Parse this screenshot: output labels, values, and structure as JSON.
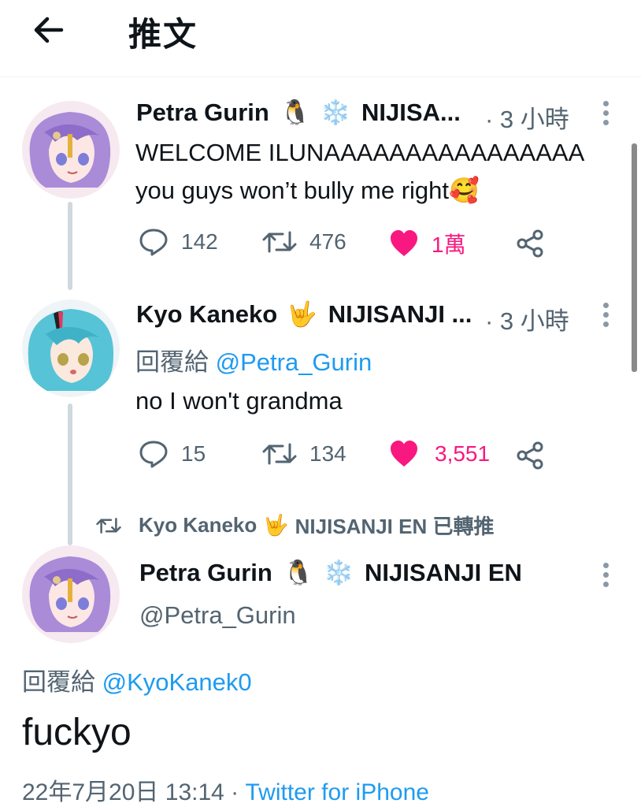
{
  "header": {
    "title": "推文"
  },
  "tweets": [
    {
      "name": "Petra Gurin",
      "emoji": [
        "🐧",
        "❄️"
      ],
      "org": "NIJISA...",
      "time": "· 3 小時",
      "lines": [
        "WELCOME ILUNAAAAAAAAAAAAAAAA",
        "you guys won’t bully me right🥰"
      ],
      "replies": "142",
      "retweets": "476",
      "likes": "1萬"
    },
    {
      "name": "Kyo Kaneko",
      "emoji": [
        "🤟"
      ],
      "org": "NIJISANJI ...",
      "time": "· 3 小時",
      "reply_prefix": "回覆給",
      "reply_handle": "@Petra_Gurin",
      "lines": [
        "no I won't grandma"
      ],
      "replies": "15",
      "retweets": "134",
      "likes": "3,551"
    }
  ],
  "retweet_banner": {
    "text": "Kyo Kaneko",
    "emoji": "🤟",
    "org_suffix": "NIJISANJI EN 已轉推"
  },
  "main": {
    "name": "Petra Gurin",
    "emoji": [
      "🐧",
      "❄️"
    ],
    "org": "NIJISANJI EN",
    "handle": "@Petra_Gurin",
    "reply_prefix": "回覆給",
    "reply_handle": "@KyoKanek0",
    "text": "fuckyo",
    "date": "22年7月20日 13:14 ·",
    "source": "Twitter for iPhone"
  },
  "colors": {
    "accent": "#1d9bf0",
    "like": "#f91880",
    "muted": "#536471"
  }
}
